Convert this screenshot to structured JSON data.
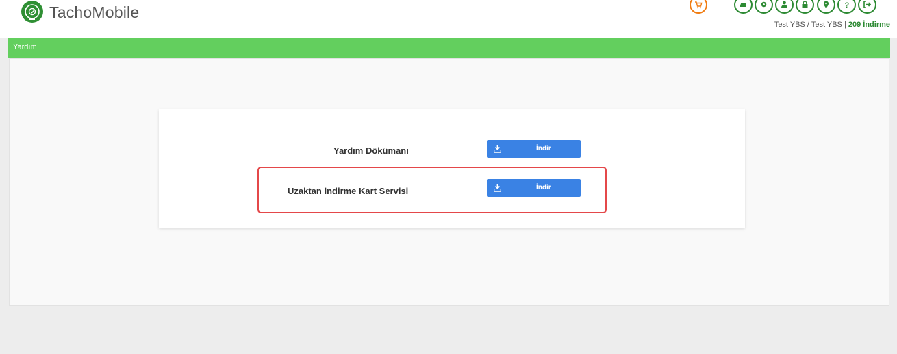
{
  "header": {
    "app_title": "TachoMobile",
    "user": "Test YBS / Test YBS",
    "separator": "|",
    "download_count": "209 İndirme",
    "icons": [
      "logo-gauge-icon",
      "cart-icon",
      "car-icon",
      "gear-icon",
      "user-icon",
      "lock-icon",
      "location-icon",
      "help-icon",
      "logout-icon"
    ],
    "colors": {
      "icon_green": "#2d8a33",
      "cart_orange": "#f07c12"
    }
  },
  "section": {
    "title": "Yardım",
    "bar_color": "#63cf5e"
  },
  "help_items": [
    {
      "label": "Yardım Dökümanı",
      "button_label": "İndir"
    },
    {
      "label": "Uzaktan İndirme Kart Servisi",
      "button_label": "İndir"
    }
  ],
  "colors": {
    "button_blue": "#3a82e4",
    "highlight_red": "#e4484a"
  }
}
